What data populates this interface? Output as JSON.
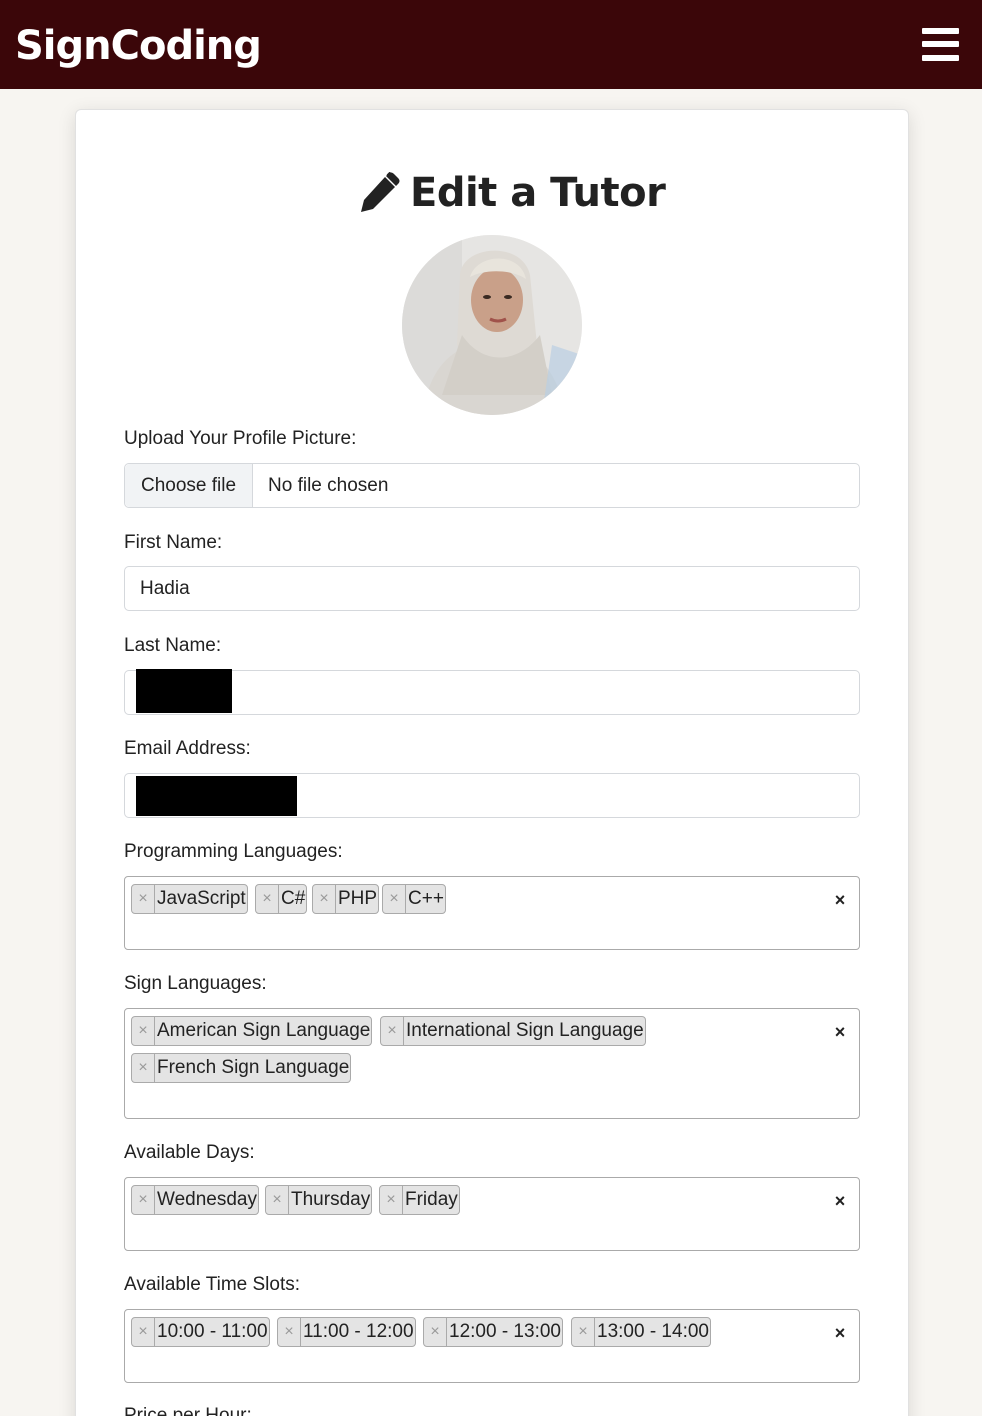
{
  "navbar": {
    "brand": "SignCoding",
    "menu_icon": "hamburger-menu-icon"
  },
  "page": {
    "title": "Edit a Tutor",
    "title_icon": "pencil-icon"
  },
  "profile_picture": {
    "label": "Upload Your Profile Picture:",
    "button_label": "Choose file",
    "status": "No file chosen"
  },
  "first_name": {
    "label": "First Name:",
    "value": "Hadia"
  },
  "last_name": {
    "label": "Last Name:",
    "value": ""
  },
  "email": {
    "label": "Email Address:",
    "value": ""
  },
  "programming_languages": {
    "label": "Programming Languages:",
    "selected": [
      "JavaScript",
      "C#",
      "PHP",
      "C++"
    ],
    "clear_label": "×"
  },
  "sign_languages": {
    "label": "Sign Languages:",
    "selected": [
      "American Sign Language",
      "International Sign Language",
      "French Sign Language"
    ],
    "clear_label": "×"
  },
  "available_days": {
    "label": "Available Days:",
    "selected": [
      "Wednesday",
      "Thursday",
      "Friday"
    ],
    "clear_label": "×"
  },
  "time_slots": {
    "label": "Available Time Slots:",
    "selected": [
      "10:00 - 11:00",
      "11:00 - 12:00",
      "12:00 - 13:00",
      "13:00 - 14:00"
    ],
    "clear_label": "×"
  },
  "price": {
    "label": "Price per Hour:"
  },
  "tag_remove_glyph": "×",
  "colors": {
    "navbar": "#3b0609",
    "page_bg": "#f7f5f1",
    "tag_bg": "#e4e4e4"
  }
}
